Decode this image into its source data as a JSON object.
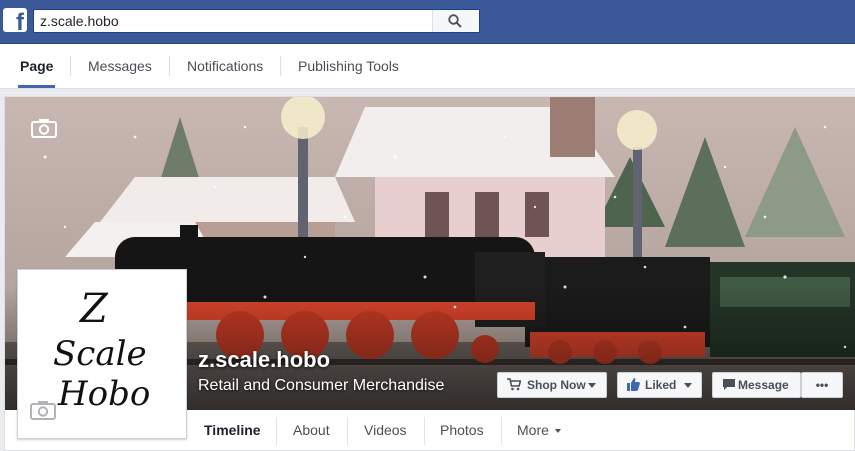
{
  "topbar": {
    "search_value": "z.scale.hobo",
    "brand_color": "#3b5998"
  },
  "tabs": [
    {
      "label": "Page"
    },
    {
      "label": "Messages"
    },
    {
      "label": "Notifications"
    },
    {
      "label": "Publishing Tools"
    }
  ],
  "profile": {
    "logo_lines": [
      "Z",
      "Scale",
      "Hobo"
    ]
  },
  "page": {
    "name": "z.scale.hobo",
    "category": "Retail and Consumer Merchandise"
  },
  "buttons": {
    "shop_now": "Shop Now",
    "liked": "Liked",
    "message": "Message",
    "more": "•••"
  },
  "subnav": [
    {
      "label": "Timeline"
    },
    {
      "label": "About"
    },
    {
      "label": "Videos"
    },
    {
      "label": "Photos"
    },
    {
      "label": "More"
    }
  ],
  "colors": {
    "link_blue": "#4267b2",
    "loco_red": "#d8432b"
  }
}
